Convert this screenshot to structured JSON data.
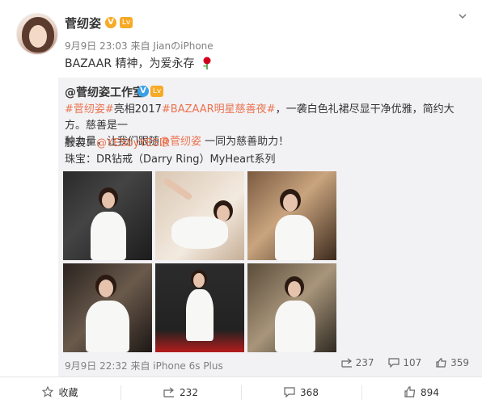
{
  "post": {
    "user": "菅纫姿",
    "badge_v": "V",
    "badge_level": "Lv",
    "time": "9月9日 23:03 来自 Jian",
    "time_suffix": "のiPhone",
    "text": "BAZAAR 精神，为爱永存"
  },
  "repost": {
    "user": "@菅纫姿工作室",
    "badge_v": "V",
    "badge_level": "Lv",
    "line1_tag1": "#菅纫姿#",
    "line1_mid": "亮相2017",
    "line1_tag2": "#BAZAAR明星慈善夜#",
    "line1_tail": "，一袭白色礼裙尽显干净优雅，简约大方。慈善是一",
    "line2_head": "种力量，让我们跟随",
    "line2_link": "@菅纫姿",
    "line2_tail": " 一同为慈善助力！",
    "line3_head": "服装：",
    "line3_link": "@YESbyYESIR",
    "line4": "珠宝：DR钻戒（Darry Ring）MyHeart系列",
    "time": "9月9日 22:32 来自 iPhone 6s Plus",
    "shares": "237",
    "comments": "107",
    "likes": "359"
  },
  "actions": {
    "favorite": "收藏",
    "share": "232",
    "comment": "368",
    "like": "894"
  },
  "colors": {
    "link": "#eb7350",
    "v_badge": "#f7aa26",
    "blue_v": "#3aa0e6"
  }
}
